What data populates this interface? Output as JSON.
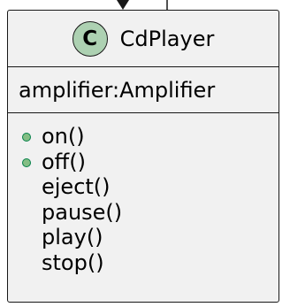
{
  "class": {
    "stereotype": "C",
    "name": "CdPlayer",
    "attributes": [
      "amplifier:Amplifier"
    ],
    "methods": [
      {
        "label": "on()",
        "public": true
      },
      {
        "label": "off()",
        "public": true
      },
      {
        "label": "eject()",
        "public": false
      },
      {
        "label": "pause()",
        "public": false
      },
      {
        "label": "play()",
        "public": false
      },
      {
        "label": "stop()",
        "public": false
      }
    ]
  },
  "colors": {
    "box_fill": "#f1f1f1",
    "border": "#181818",
    "stereotype_fill": "#add1b2",
    "public_dot": "#84be84"
  }
}
